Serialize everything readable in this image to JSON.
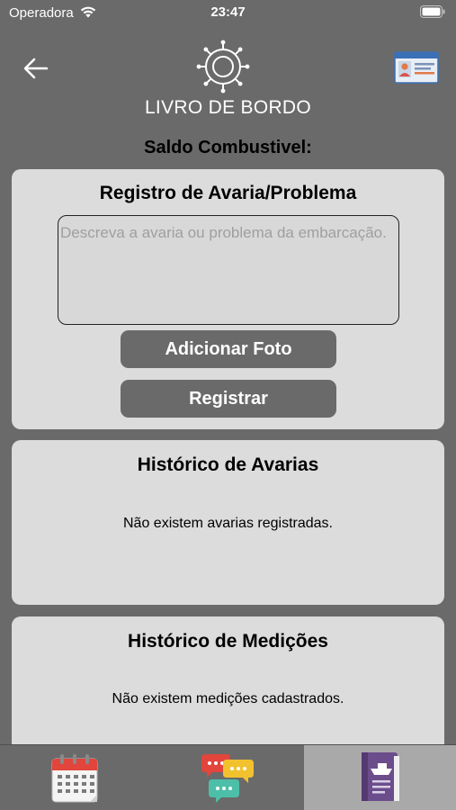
{
  "status_bar": {
    "carrier": "Operadora",
    "time": "23:47"
  },
  "header": {
    "back_icon": "arrow-left-icon",
    "logo_icon": "ship-wheel-icon",
    "id_card_icon": "id-card-icon",
    "title": "LIVRO DE BORDO"
  },
  "fuel": {
    "label": "Saldo Combustivel:"
  },
  "damage_form": {
    "title": "Registro de Avaria/Problema",
    "description_value": "",
    "description_placeholder": "Descreva a avaria ou problema da embarcação.",
    "add_photo_label": "Adicionar Foto",
    "register_label": "Registrar"
  },
  "damage_history": {
    "title": "Histórico de Avarias",
    "empty_text": "Não existem avarias registradas."
  },
  "measurement_history": {
    "title": "Histórico de Medições",
    "empty_text": "Não existem medições cadastrados."
  },
  "tab_bar": {
    "tabs": [
      {
        "icon": "calendar-icon",
        "selected": false
      },
      {
        "icon": "chat-bubbles-icon",
        "selected": false
      },
      {
        "icon": "logbook-icon",
        "selected": true
      }
    ]
  },
  "colors": {
    "background": "#6a6a6a",
    "card": "#dcdcdc",
    "button": "#6a6a6a",
    "selected_tab": "#a9a9a9"
  }
}
